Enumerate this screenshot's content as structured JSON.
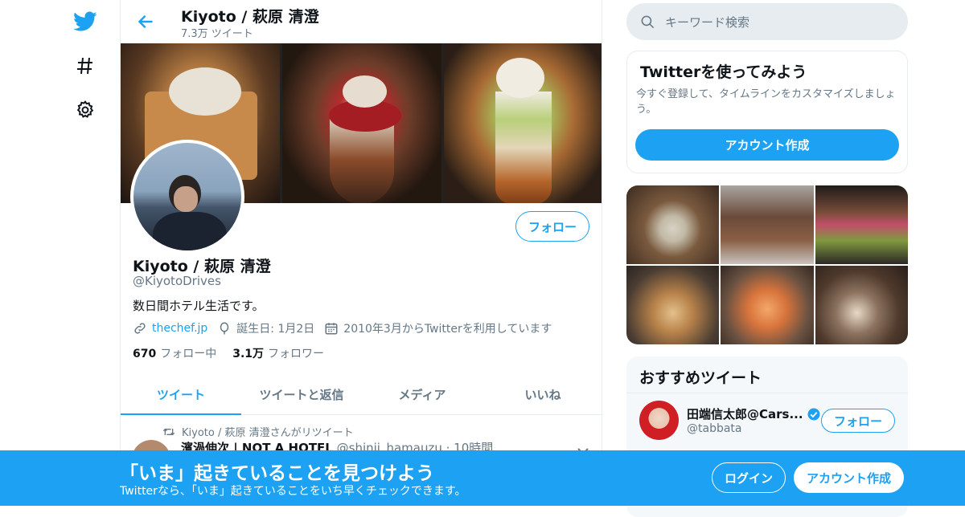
{
  "nav": {
    "icons": [
      "twitter-logo-icon",
      "hashtag-icon",
      "settings-gear-icon"
    ]
  },
  "header": {
    "title": "Kiyoto / 萩原 清澄",
    "tweet_count": "7.3万 ツイート"
  },
  "profile": {
    "follow_label": "フォロー",
    "name": "Kiyoto / 萩原 清澄",
    "handle": "@KiyotoDrives",
    "bio": "数日間ホテル生活です。",
    "website": "thechef.jp",
    "birthday": "誕生日: 1月2日",
    "joined": "2010年3月からTwitterを利用しています",
    "following_count": "670",
    "following_label": "フォロー中",
    "followers_count": "3.1万",
    "followers_label": "フォロワー"
  },
  "tabs": [
    {
      "label": "ツイート",
      "active": true
    },
    {
      "label": "ツイートと返信",
      "active": false
    },
    {
      "label": "メディア",
      "active": false
    },
    {
      "label": "いいね",
      "active": false
    }
  ],
  "timeline": {
    "retweet_label": "Kiyoto / 萩原 清澄さんがリツイート",
    "tweet_author": "濱渦伸次 | NOT A HOTEL",
    "tweet_meta": "@shinji_hamauzu · 10時間"
  },
  "search": {
    "placeholder": "キーワード検索"
  },
  "signup_card": {
    "title": "Twitterを使ってみよう",
    "text": "今すぐ登録して、タイムラインをカスタマイズしましょう。",
    "button": "アカウント作成"
  },
  "recommended": {
    "title": "おすすめツイート",
    "name": "田端信太郎@Cars...",
    "handle": "@tabbata",
    "follow_label": "フォロー"
  },
  "bottom_bar": {
    "title": "「いま」起きていることを見つけよう",
    "subtitle": "Twitterなら、「いま」起きていることをいち早くチェックできます。",
    "login": "ログイン",
    "signup": "アカウント作成"
  },
  "colors": {
    "accent": "#1da1f2",
    "text": "#0f1419",
    "muted": "#657786",
    "border": "#e6ecf0"
  }
}
